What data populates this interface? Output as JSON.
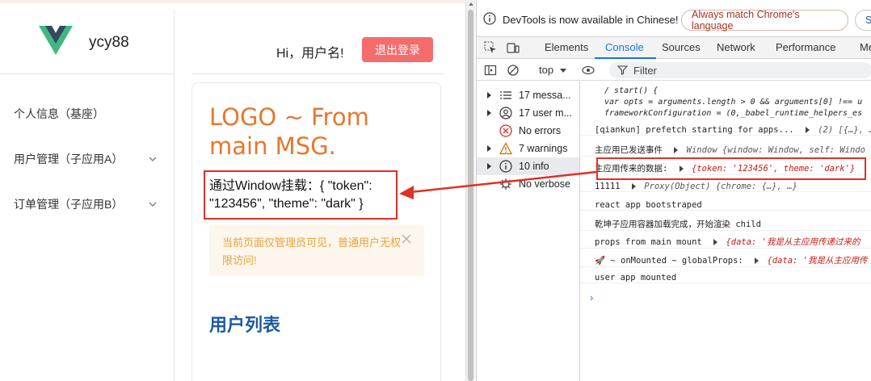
{
  "app": {
    "brand_name": "ycy88",
    "menu": [
      {
        "label": "个人信息（基座）"
      },
      {
        "label": "用户管理（子应用A）"
      },
      {
        "label": "订单管理（子应用B）"
      }
    ],
    "greeting": "Hi，用户名!",
    "logout_label": "退出登录",
    "logo_msg": "LOGO ~ From main MSG.",
    "window_msg": "通过Window挂载：{ \"token\": \"123456\", \"theme\": \"dark\" }",
    "alert_text": "当前页面仅管理员可见，普通用户无权限访问!",
    "user_list_title": "用户列表",
    "colors": {
      "accent": "#e6772e",
      "logout": "#f56c6c",
      "title": "#1f5b9e",
      "alert_bg": "#fdf6ec",
      "alert_text": "#e6a23c",
      "vue_green": "#41b883",
      "vue_dark": "#35495e"
    }
  },
  "devtools": {
    "notice": "DevTools is now available in Chinese!",
    "match_button": "Always match Chrome's language",
    "switch_button": "S",
    "tabs": [
      "Elements",
      "Console",
      "Sources",
      "Network",
      "Performance",
      "Men"
    ],
    "active_tab": "Console",
    "context": "top",
    "filter_placeholder": "Filter",
    "categories": [
      {
        "label": "17 messa...",
        "icon": "list-icon"
      },
      {
        "label": "17 user m...",
        "icon": "user-icon"
      },
      {
        "label": "No errors",
        "icon": "error-icon"
      },
      {
        "label": "7 warnings",
        "icon": "warning-icon"
      },
      {
        "label": "10 info",
        "icon": "info-icon",
        "selected": true
      },
      {
        "label": "No verbose",
        "icon": "verbose-icon"
      }
    ],
    "code_lines": [
      "/ start() {",
      "  var opts = arguments.length > 0 && arguments[0] !== u",
      "  frameworkConfiguration = (0,_babel_runtime_helpers_es"
    ],
    "log_lines": [
      {
        "text": "[qiankun] prefetch starting for apps...",
        "detail": "(2)  [{…}, …"
      },
      {
        "text": "主应用已发送事件",
        "detail": "Window  {window: Window, self: Windo"
      },
      {
        "text": "主应用传来的数据:",
        "detail": "{token: '123456', theme: 'dark'}"
      },
      {
        "text": "11111",
        "detail": "Proxy(Object)  {chrome: {…}, …}"
      },
      {
        "text": "react app bootstraped",
        "detail": ""
      },
      {
        "text": "乾坤子应用容器加载完成，开始渲染 child",
        "detail": ""
      },
      {
        "text": "props from main mount",
        "detail": "{data: '我是从主应用传递过来的"
      },
      {
        "text": "🚀 ~ onMounted ~ globalProps:",
        "detail": "{data: '我是从主应用传"
      },
      {
        "text": "user app mounted",
        "detail": ""
      }
    ],
    "prompt_symbol": "›"
  }
}
